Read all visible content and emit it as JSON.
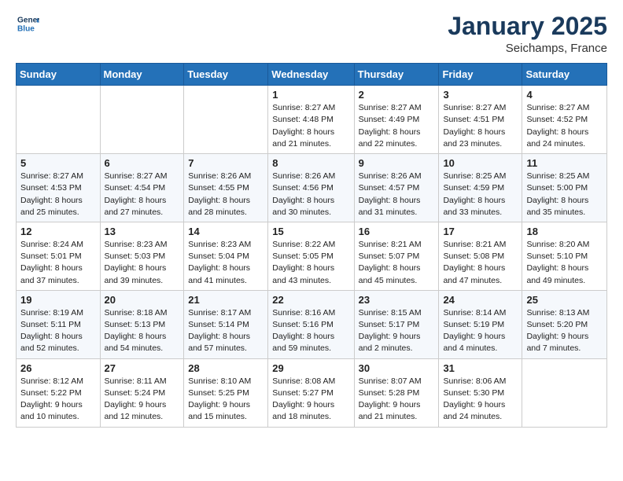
{
  "header": {
    "logo_general": "General",
    "logo_blue": "Blue",
    "title": "January 2025",
    "location": "Seichamps, France"
  },
  "weekdays": [
    "Sunday",
    "Monday",
    "Tuesday",
    "Wednesday",
    "Thursday",
    "Friday",
    "Saturday"
  ],
  "weeks": [
    [
      {
        "day": "",
        "info": ""
      },
      {
        "day": "",
        "info": ""
      },
      {
        "day": "",
        "info": ""
      },
      {
        "day": "1",
        "info": "Sunrise: 8:27 AM\nSunset: 4:48 PM\nDaylight: 8 hours\nand 21 minutes."
      },
      {
        "day": "2",
        "info": "Sunrise: 8:27 AM\nSunset: 4:49 PM\nDaylight: 8 hours\nand 22 minutes."
      },
      {
        "day": "3",
        "info": "Sunrise: 8:27 AM\nSunset: 4:51 PM\nDaylight: 8 hours\nand 23 minutes."
      },
      {
        "day": "4",
        "info": "Sunrise: 8:27 AM\nSunset: 4:52 PM\nDaylight: 8 hours\nand 24 minutes."
      }
    ],
    [
      {
        "day": "5",
        "info": "Sunrise: 8:27 AM\nSunset: 4:53 PM\nDaylight: 8 hours\nand 25 minutes."
      },
      {
        "day": "6",
        "info": "Sunrise: 8:27 AM\nSunset: 4:54 PM\nDaylight: 8 hours\nand 27 minutes."
      },
      {
        "day": "7",
        "info": "Sunrise: 8:26 AM\nSunset: 4:55 PM\nDaylight: 8 hours\nand 28 minutes."
      },
      {
        "day": "8",
        "info": "Sunrise: 8:26 AM\nSunset: 4:56 PM\nDaylight: 8 hours\nand 30 minutes."
      },
      {
        "day": "9",
        "info": "Sunrise: 8:26 AM\nSunset: 4:57 PM\nDaylight: 8 hours\nand 31 minutes."
      },
      {
        "day": "10",
        "info": "Sunrise: 8:25 AM\nSunset: 4:59 PM\nDaylight: 8 hours\nand 33 minutes."
      },
      {
        "day": "11",
        "info": "Sunrise: 8:25 AM\nSunset: 5:00 PM\nDaylight: 8 hours\nand 35 minutes."
      }
    ],
    [
      {
        "day": "12",
        "info": "Sunrise: 8:24 AM\nSunset: 5:01 PM\nDaylight: 8 hours\nand 37 minutes."
      },
      {
        "day": "13",
        "info": "Sunrise: 8:23 AM\nSunset: 5:03 PM\nDaylight: 8 hours\nand 39 minutes."
      },
      {
        "day": "14",
        "info": "Sunrise: 8:23 AM\nSunset: 5:04 PM\nDaylight: 8 hours\nand 41 minutes."
      },
      {
        "day": "15",
        "info": "Sunrise: 8:22 AM\nSunset: 5:05 PM\nDaylight: 8 hours\nand 43 minutes."
      },
      {
        "day": "16",
        "info": "Sunrise: 8:21 AM\nSunset: 5:07 PM\nDaylight: 8 hours\nand 45 minutes."
      },
      {
        "day": "17",
        "info": "Sunrise: 8:21 AM\nSunset: 5:08 PM\nDaylight: 8 hours\nand 47 minutes."
      },
      {
        "day": "18",
        "info": "Sunrise: 8:20 AM\nSunset: 5:10 PM\nDaylight: 8 hours\nand 49 minutes."
      }
    ],
    [
      {
        "day": "19",
        "info": "Sunrise: 8:19 AM\nSunset: 5:11 PM\nDaylight: 8 hours\nand 52 minutes."
      },
      {
        "day": "20",
        "info": "Sunrise: 8:18 AM\nSunset: 5:13 PM\nDaylight: 8 hours\nand 54 minutes."
      },
      {
        "day": "21",
        "info": "Sunrise: 8:17 AM\nSunset: 5:14 PM\nDaylight: 8 hours\nand 57 minutes."
      },
      {
        "day": "22",
        "info": "Sunrise: 8:16 AM\nSunset: 5:16 PM\nDaylight: 8 hours\nand 59 minutes."
      },
      {
        "day": "23",
        "info": "Sunrise: 8:15 AM\nSunset: 5:17 PM\nDaylight: 9 hours\nand 2 minutes."
      },
      {
        "day": "24",
        "info": "Sunrise: 8:14 AM\nSunset: 5:19 PM\nDaylight: 9 hours\nand 4 minutes."
      },
      {
        "day": "25",
        "info": "Sunrise: 8:13 AM\nSunset: 5:20 PM\nDaylight: 9 hours\nand 7 minutes."
      }
    ],
    [
      {
        "day": "26",
        "info": "Sunrise: 8:12 AM\nSunset: 5:22 PM\nDaylight: 9 hours\nand 10 minutes."
      },
      {
        "day": "27",
        "info": "Sunrise: 8:11 AM\nSunset: 5:24 PM\nDaylight: 9 hours\nand 12 minutes."
      },
      {
        "day": "28",
        "info": "Sunrise: 8:10 AM\nSunset: 5:25 PM\nDaylight: 9 hours\nand 15 minutes."
      },
      {
        "day": "29",
        "info": "Sunrise: 8:08 AM\nSunset: 5:27 PM\nDaylight: 9 hours\nand 18 minutes."
      },
      {
        "day": "30",
        "info": "Sunrise: 8:07 AM\nSunset: 5:28 PM\nDaylight: 9 hours\nand 21 minutes."
      },
      {
        "day": "31",
        "info": "Sunrise: 8:06 AM\nSunset: 5:30 PM\nDaylight: 9 hours\nand 24 minutes."
      },
      {
        "day": "",
        "info": ""
      }
    ]
  ]
}
